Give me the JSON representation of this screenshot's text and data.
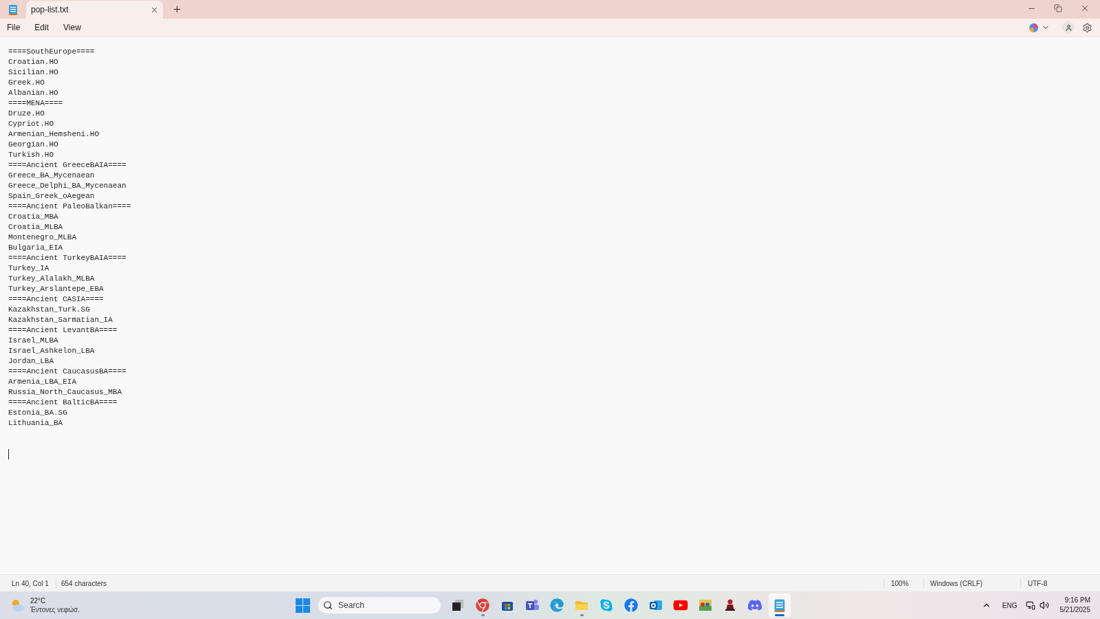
{
  "tabs": [
    {
      "label": "pop-list.txt",
      "selected": true
    }
  ],
  "menu": [
    "File",
    "Edit",
    "View"
  ],
  "editor": {
    "lines": [
      "====SouthEurope====",
      "Croatian.HO",
      "Sicilian.HO",
      "Greek.HO",
      "Albanian.HO",
      "====MENA====",
      "Druze.HO",
      "Cypriot.HO",
      "Armenian_Hemsheni.HO",
      "Georgian.HO",
      "Turkish.HO",
      "====Ancient GreeceBAIA====",
      "Greece_BA_Mycenaean",
      "Greece_Delphi_BA_Mycenaean",
      "Spain_Greek_oAegean",
      "====Ancient PaleoBalkan====",
      "Croatia_MBA",
      "Croatia_MLBA",
      "Montenegro_MLBA",
      "Bulgaria_EIA",
      "====Ancient TurkeyBAIA====",
      "Turkey_IA",
      "Turkey_Alalakh_MLBA",
      "Turkey_Arslantepe_EBA",
      "====Ancient CASIA====",
      "Kazakhstan_Turk.SG",
      "Kazakhstan_Sarmatian_IA",
      "====Ancient LevantBA====",
      "Israel_MLBA",
      "Israel_Ashkelon_LBA",
      "Jordan_LBA",
      "====Ancient CaucasusBA====",
      "Armenia_LBA_EIA",
      "Russia_North_Caucasus_MBA",
      "====Ancient BalticBA====",
      "Estonia_BA.SG",
      "Lithuania_BA"
    ]
  },
  "status_bar": {
    "position": "Ln 40, Col 1",
    "characters": "654 characters",
    "zoom": "100%",
    "line_endings": "Windows (CRLF)",
    "encoding": "UTF-8"
  },
  "taskbar": {
    "weather": {
      "temperature": "22°C",
      "condition": "Έντονες νεφώσ."
    },
    "search": {
      "placeholder": "Search"
    },
    "apps": [
      {
        "kind": "taskview",
        "running": false,
        "selected": false
      },
      {
        "kind": "chrome",
        "running": true,
        "selected": false
      },
      {
        "kind": "store",
        "running": false,
        "selected": false
      },
      {
        "kind": "teams",
        "running": false,
        "selected": false
      },
      {
        "kind": "edge",
        "running": false,
        "selected": false
      },
      {
        "kind": "explorer",
        "running": true,
        "selected": false
      },
      {
        "kind": "skype",
        "running": false,
        "selected": false
      },
      {
        "kind": "facebook",
        "running": false,
        "selected": false
      },
      {
        "kind": "outlook",
        "running": false,
        "selected": false
      },
      {
        "kind": "youtube",
        "running": false,
        "selected": false
      },
      {
        "kind": "photos",
        "running": false,
        "selected": false
      },
      {
        "kind": "game",
        "running": false,
        "selected": false
      },
      {
        "kind": "discord",
        "running": false,
        "selected": false
      },
      {
        "kind": "notepad",
        "running": true,
        "selected": true
      }
    ],
    "language": "ENG",
    "time": "9:16 PM",
    "date": "5/21/2025"
  }
}
